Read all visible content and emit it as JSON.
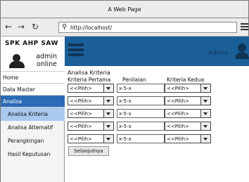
{
  "window": {
    "title": "A Web Page"
  },
  "browser": {
    "back_icon": "arrow-left-icon",
    "forward_icon": "arrow-right-icon",
    "reload_icon": "reload-icon",
    "url": "http://localhost/",
    "search_icon": "search-icon",
    "menu_icon": "hamburger-menu-icon"
  },
  "brand": {
    "app_name": "SPK AHP SAW",
    "user_line1": "admin",
    "user_line2": "online"
  },
  "sidebar": {
    "items": [
      {
        "label": "Home"
      },
      {
        "label": "Data Master"
      },
      {
        "label": "Analisa"
      }
    ],
    "sub_items": [
      {
        "label": "Analisa Kriteria"
      },
      {
        "label": "Analisa Alternatif"
      },
      {
        "label": "Perangkingan"
      },
      {
        "label": "Hasil Keputusan"
      }
    ]
  },
  "header": {
    "admin_label": "Admin"
  },
  "main": {
    "heading": "Analisa Kriteria",
    "columns": [
      "Kriteria Pertama",
      "Penilaian",
      "Kriteria Kedua"
    ],
    "rows": [
      {
        "kriteria_pertama": "<<Pilih>",
        "penilaian": "x-5-x",
        "kriteria_kedua": "<<Pilih>"
      },
      {
        "kriteria_pertama": "<<Pilih>",
        "penilaian": "x-5-x",
        "kriteria_kedua": "<<Pilih>"
      },
      {
        "kriteria_pertama": "<<Pilih>",
        "penilaian": "x-5-x",
        "kriteria_kedua": "<<Pilih>"
      },
      {
        "kriteria_pertama": "<<Pilih>",
        "penilaian": "x-5-x",
        "kriteria_kedua": "<<Pilih>"
      },
      {
        "kriteria_pertama": "<<Pilih>",
        "penilaian": "x-5-x",
        "kriteria_kedua": "<<Pilih>"
      }
    ],
    "next_button": "Selanjutnya"
  },
  "colors": {
    "header_bg": "#1b5f99",
    "active_nav": "#2b6bb5",
    "active_sub": "#a9c9ee"
  }
}
